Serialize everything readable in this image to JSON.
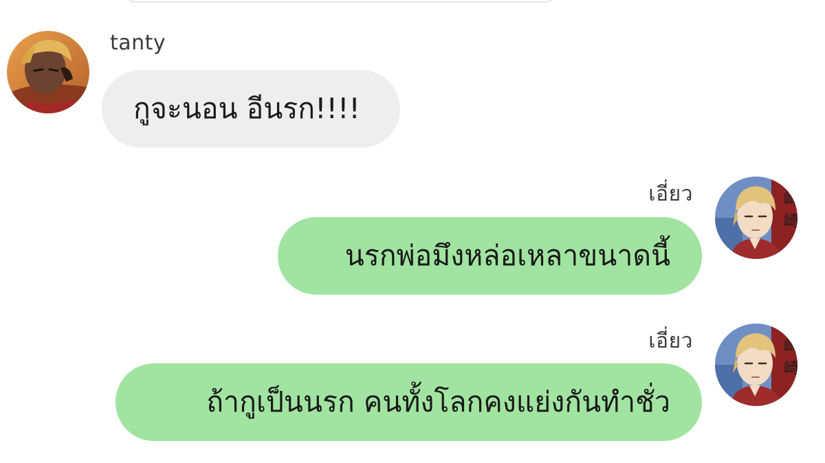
{
  "conversation": {
    "messages": [
      {
        "direction": "incoming",
        "sender": "tanty",
        "text": "กูจะนอน อีนรก!!!!",
        "avatar_icon": "avatar-tanty-icon"
      },
      {
        "direction": "outgoing",
        "sender": "เอี่ยว",
        "text": "นรกพ่อมึงหล่อเหลาขนาดนี้",
        "avatar_icon": "avatar-blond-icon"
      },
      {
        "direction": "outgoing",
        "sender": "เอี่ยว",
        "text": "ถ้ากูเป็นนรก คนทั้งโลกคงแย่งกันทำชั่ว",
        "avatar_icon": "avatar-blond-icon"
      }
    ]
  },
  "colors": {
    "incoming_bubble": "#eeeeee",
    "outgoing_bubble": "#a1e4a1",
    "text": "#1a1a1a",
    "name": "#3a3a3a"
  }
}
